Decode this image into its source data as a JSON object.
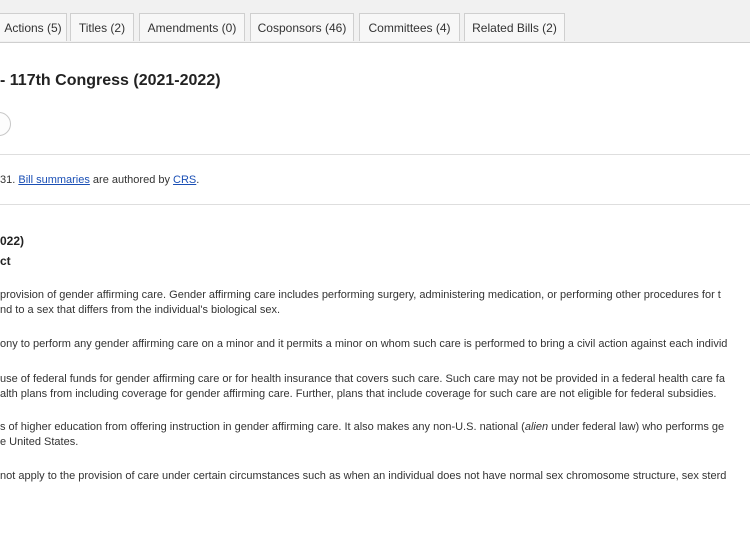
{
  "tabs": [
    {
      "label": "Actions (5)"
    },
    {
      "label": "Titles (2)"
    },
    {
      "label": "Amendments (0)"
    },
    {
      "label": "Cosponsors (46)"
    },
    {
      "label": "Committees (4)"
    },
    {
      "label": "Related Bills (2)"
    }
  ],
  "bill": {
    "title": "- 117th Congress (2021-2022)"
  },
  "source": {
    "prefix": "31. ",
    "link1": "Bill summaries",
    "middle": " are authored by ",
    "link2": "CRS",
    "suffix": "."
  },
  "summary": {
    "heading": "022)",
    "subheading": "ct",
    "p1_line1": "provision of gender affirming care. Gender affirming care includes performing surgery, administering medication, or performing other procedures for t",
    "p1_line2": "nd to a sex that differs from the individual's biological sex.",
    "p2_line1": "ony to perform any gender affirming care on a minor and it permits a minor on whom such care is performed to bring a civil action against each individ",
    "p3_line1": "use of federal funds for gender affirming care or for health insurance that covers such care. Such care may not be provided in a federal health care fa",
    "p3_line2": "alth plans from including coverage for gender affirming care. Further, plans that include coverage for such care are not eligible for federal subsidies.",
    "p4_line1_a": "s of higher education from offering instruction in gender affirming care. It also makes any non-U.S. national (",
    "p4_line1_em": "alien",
    "p4_line1_b": " under federal law) who performs ge",
    "p4_line2": "e United States.",
    "p5_line1": "not apply to the provision of care under certain circumstances such as when an individual does not have normal sex chromosome structure, sex sterd"
  }
}
